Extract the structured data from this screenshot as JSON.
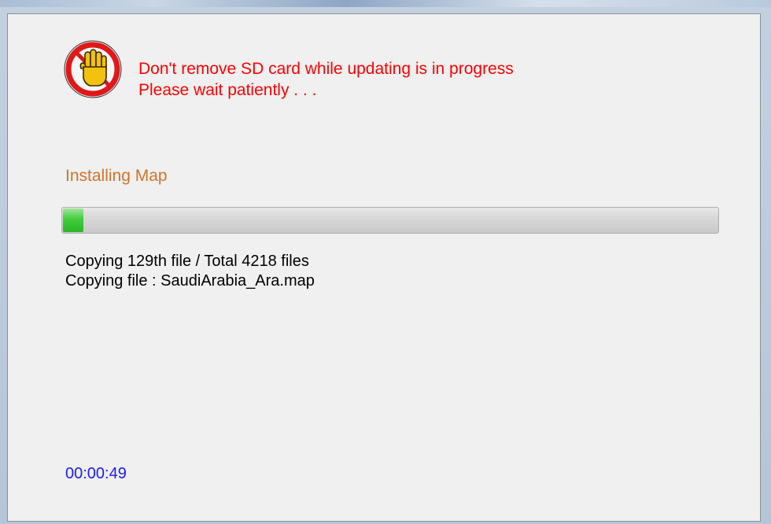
{
  "window": {
    "title": ""
  },
  "warning": {
    "line1": "Don't remove SD card while updating is in progress",
    "line2": "Please wait patiently . . .",
    "icon": "stop-hand-icon",
    "color": "#ff0000"
  },
  "stage": {
    "label": "Installing Map",
    "color": "#d0742a"
  },
  "progress": {
    "fraction": 0.031,
    "color": "#42cc3e"
  },
  "status": {
    "count_line": "Copying 129th file / Total 4218 files",
    "file_line": "Copying file : SaudiArabia_Ara.map"
  },
  "elapsed": {
    "time": "00:00:49",
    "color": "#1a1aff"
  }
}
